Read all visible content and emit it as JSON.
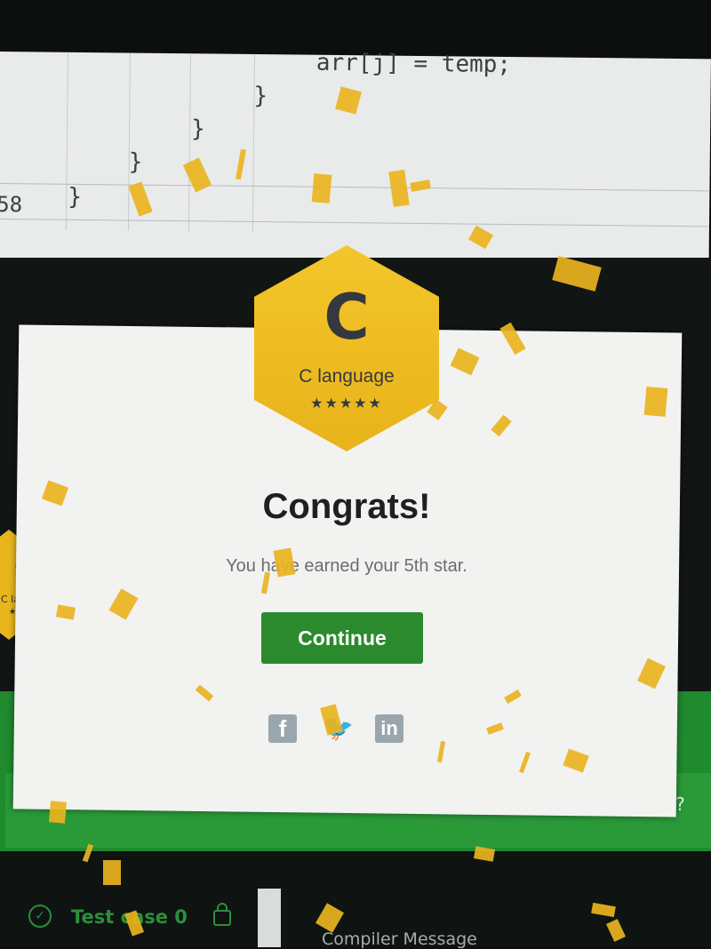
{
  "editor": {
    "code_lines": [
      "arr[j] = temp;",
      "}",
      "}",
      "}",
      "}"
    ],
    "line_number": "58"
  },
  "modal": {
    "badge": {
      "letter": "C",
      "title": "C language",
      "stars": "★★★★★"
    },
    "heading": "Congrats!",
    "message": "You have earned your 5th star.",
    "continue_label": "Continue",
    "share": {
      "facebook": "f",
      "twitter": "🐦",
      "linkedin": "in"
    }
  },
  "background": {
    "side_badge": {
      "letter": "C",
      "title": "C lan",
      "stars": "★★"
    },
    "partial_text": "ends?",
    "test_case_label": "Test case 0",
    "compiler_message_label": "Compiler Message"
  },
  "colors": {
    "accent_green": "#2a8a2d",
    "badge_gold": "#e8b31a",
    "confetti_gold": "#e9b41f"
  }
}
